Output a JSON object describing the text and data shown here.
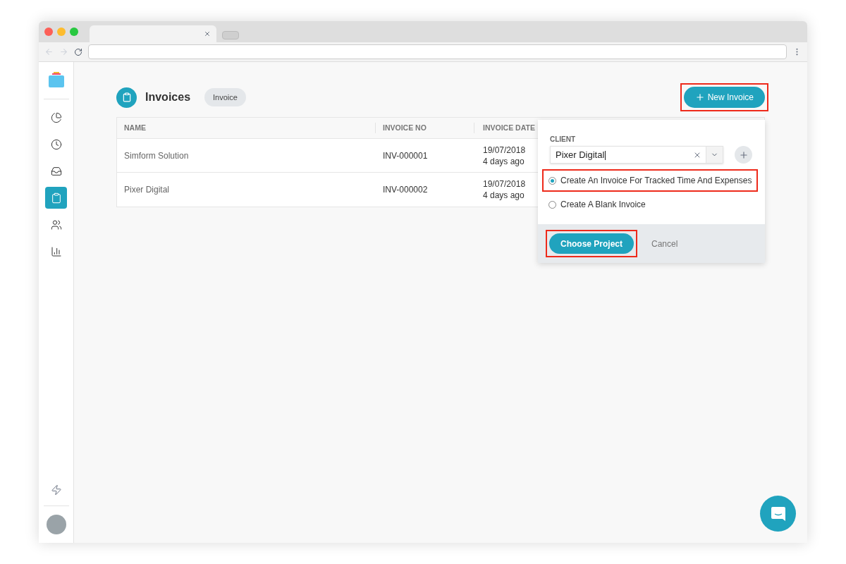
{
  "sidebar": {
    "items": [
      {
        "selected": false
      },
      {
        "selected": false
      },
      {
        "selected": false
      },
      {
        "selected": true
      },
      {
        "selected": false
      },
      {
        "selected": false
      }
    ]
  },
  "header": {
    "title": "Invoices",
    "badge": "Invoice",
    "new_button": "New Invoice"
  },
  "table": {
    "columns": [
      "NAME",
      "INVOICE NO",
      "INVOICE DATE"
    ],
    "rows": [
      {
        "name": "Simform Solution",
        "invoice_no": "INV-000001",
        "date": "19/07/2018",
        "relative": "4 days ago"
      },
      {
        "name": "Pixer Digital",
        "invoice_no": "INV-000002",
        "date": "19/07/2018",
        "relative": "4 days ago"
      }
    ]
  },
  "popover": {
    "label": "CLIENT",
    "value": "Pixer Digital",
    "options": [
      {
        "label": "Create An Invoice For Tracked Time And Expenses",
        "selected": true,
        "highlighted": true
      },
      {
        "label": "Create A Blank Invoice",
        "selected": false,
        "highlighted": false
      }
    ],
    "primary": "Choose Project",
    "secondary": "Cancel"
  }
}
